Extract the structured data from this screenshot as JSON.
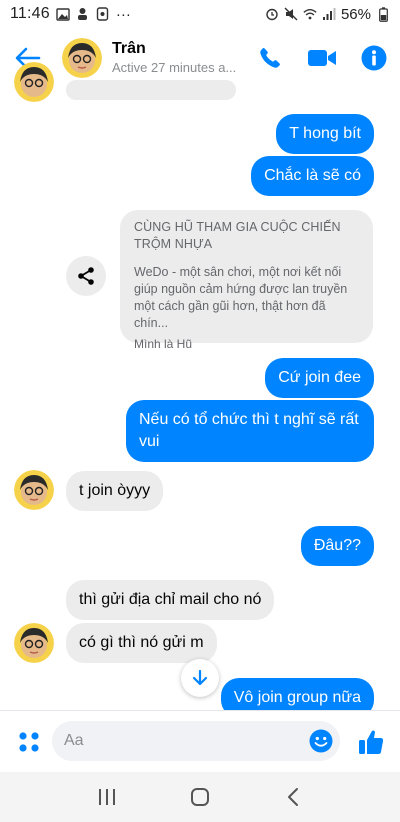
{
  "status_bar": {
    "time": "11:46",
    "battery": "56%",
    "more": "···"
  },
  "header": {
    "contact_name": "Trân",
    "contact_status": "Active 27 minutes a...",
    "icons": [
      "back-arrow-icon",
      "phone-icon",
      "video-camera-icon",
      "info-icon"
    ],
    "accent_color": "#0084ff"
  },
  "messages": {
    "m1": "T hong bít",
    "m2": "Chắc là sẽ có",
    "m3": "Cứ join đee",
    "m4": "Nếu có tổ chức thì t nghĩ sẽ rất vui",
    "m5": "t join òyyy",
    "m6": "Đâu??",
    "m7": "thì gửi địa chỉ mail cho nó",
    "m8": "có gì thì nó gửi m",
    "m9": "Vô join group nữa"
  },
  "shared_link": {
    "title": "CÙNG HŨ THAM GIA CUỘC CHIẾN TRỘM NHỰA",
    "description": "WeDo - một sân chơi, một nơi kết nối giúp nguồn cảm hứng được lan truyền một cách gần gũi hơn, thật hơn đã chín...",
    "source": "Mình là Hũ"
  },
  "composer": {
    "placeholder": "Aa"
  },
  "colors": {
    "outgoing_bubble": "#0084ff",
    "incoming_bubble": "#ececec"
  }
}
